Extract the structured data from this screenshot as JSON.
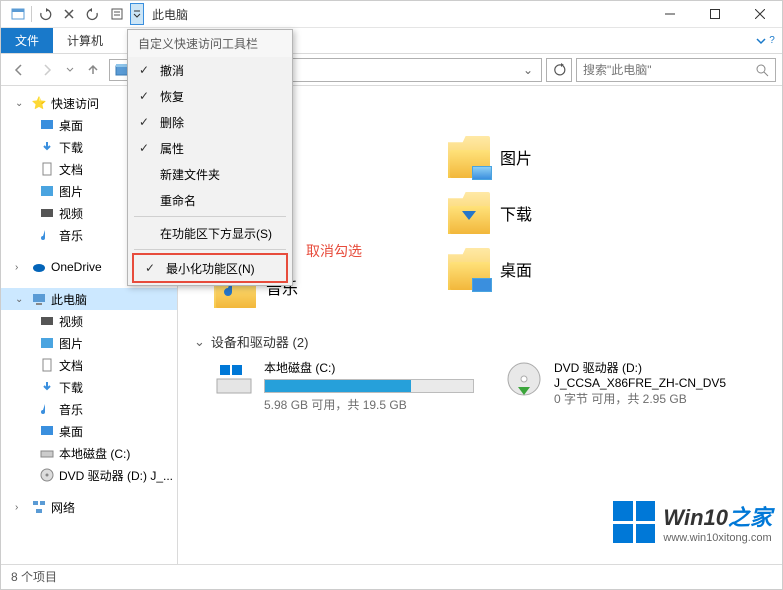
{
  "title": "此电脑",
  "ribbon": {
    "file": "文件",
    "tab1": "计算机",
    "expand_hint": "v"
  },
  "search": {
    "placeholder": "搜索\"此电脑\""
  },
  "menu": {
    "title": "自定义快速访问工具栏",
    "items": [
      {
        "label": "撤消",
        "checked": true
      },
      {
        "label": "恢复",
        "checked": true
      },
      {
        "label": "删除",
        "checked": true
      },
      {
        "label": "属性",
        "checked": true
      },
      {
        "label": "新建文件夹",
        "checked": false
      },
      {
        "label": "重命名",
        "checked": false
      }
    ],
    "bottom1": "在功能区下方显示(S)",
    "bottom2": "最小化功能区(N)",
    "bottom2_checked": true
  },
  "annotation": "取消勾选",
  "sidebar": {
    "quick": "快速访问",
    "items_quick": [
      "桌面",
      "下载",
      "文档",
      "图片",
      "视频",
      "音乐"
    ],
    "onedrive": "OneDrive",
    "thispc": "此电脑",
    "items_pc": [
      "视频",
      "图片",
      "文档",
      "下载",
      "音乐",
      "桌面",
      "本地磁盘 (C:)",
      "DVD 驱动器 (D:) J_..."
    ],
    "network": "网络"
  },
  "content": {
    "section_devices": "设备和驱动器 (2)",
    "music": "音乐",
    "folders": [
      "图片",
      "下载",
      "桌面"
    ],
    "drive_c": {
      "name": "本地磁盘 (C:)",
      "sub": "5.98 GB 可用，共 19.5 GB",
      "fill": 70
    },
    "drive_d": {
      "name": "DVD 驱动器 (D:)",
      "sub2": "J_CCSA_X86FRE_ZH-CN_DV5",
      "sub": "0 字节 可用，共 2.95 GB"
    }
  },
  "status": "8 个项目",
  "watermark": {
    "brand": "Win10",
    "suffix": "之家",
    "url": "www.win10xitong.com"
  }
}
